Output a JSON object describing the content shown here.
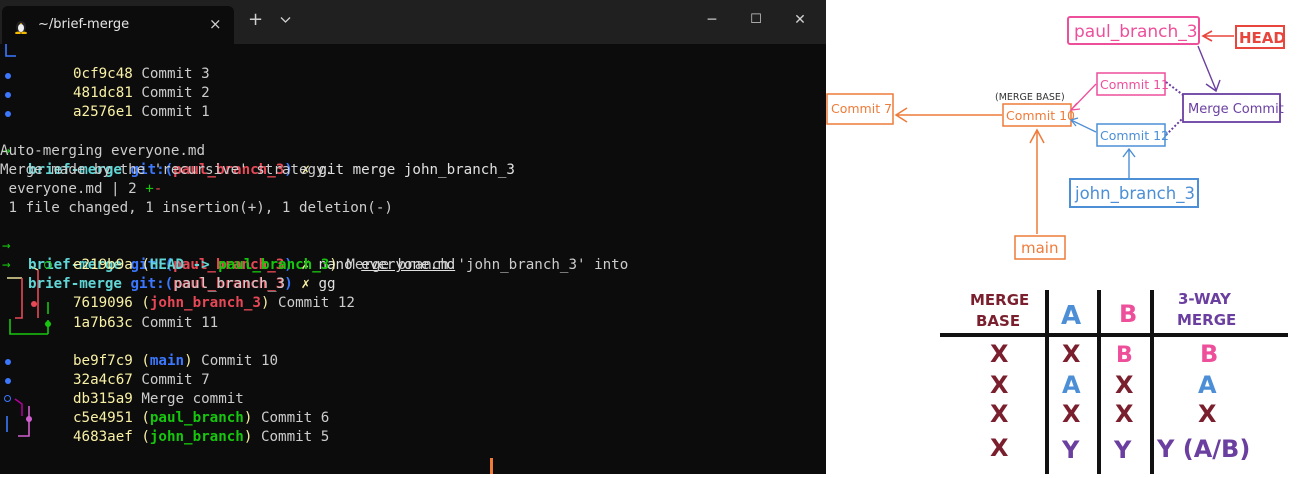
{
  "window": {
    "tab_title": "~/brief-merge",
    "new_tab": "+",
    "dropdown": "⌄",
    "close_tab": "×",
    "minimize": "─",
    "maximize": "☐",
    "close": "✕"
  },
  "terminal": {
    "l1": {
      "hash": "0cf9c48",
      "msg": " Commit 3"
    },
    "l2": {
      "hash": "481dc81",
      "msg": " Commit 2"
    },
    "l3": {
      "hash": "a2576e1",
      "msg": " Commit 1"
    },
    "p1": {
      "arrow": "→",
      "dir": "brief-merge",
      "git": "git:(",
      "branch": "paul_branch_3",
      "close": ")",
      "x": "✗",
      "cmd": "git merge john_branch_3"
    },
    "o1": "Auto-merging everyone.md",
    "o2": "Merge made by the 'recursive' strategy.",
    "o3": {
      "file": " everyone.md | 2 ",
      "plus": "+",
      "minus": "-"
    },
    "o4": " 1 file changed, 1 insertion(+), 1 deletion(-)",
    "p2": {
      "arrow": "→",
      "dir": "brief-merge",
      "git": "git:(",
      "branch": "paul_branch_3",
      "close": ")",
      "x": "✗",
      "cmd": "nano ",
      "file": "everyone.md"
    },
    "p3": {
      "arrow": "→",
      "dir": "brief-merge",
      "git": "git:(",
      "branch": "paul_branch_3",
      "close": ")",
      "x": "✗",
      "cmd": "gg"
    },
    "c1": {
      "hash": "e219b9a",
      "open": " (",
      "head": "HEAD -> ",
      "branch": "paul_branch_3",
      "close": ")",
      "msg": " Merge branch 'john_branch_3' into",
      "msg2": "paul_branch_3"
    },
    "c2": {
      "hash": "7619096",
      "open": " (",
      "branch": "john_branch_3",
      "close": ")",
      "msg": " Commit 12"
    },
    "c3": {
      "hash": "1a7b63c",
      "msg": " Commit 11"
    },
    "c4": {
      "hash": "be9f7c9",
      "open": " (",
      "branch": "main",
      "close": ")",
      "msg": " Commit 10"
    },
    "c5": {
      "hash": "32a4c67",
      "msg": " Commit 7"
    },
    "c6": {
      "hash": "db315a9",
      "msg": " Merge commit"
    },
    "c7": {
      "hash": "c5e4951",
      "open": " (",
      "branch": "paul_branch",
      "close": ")",
      "msg": " Commit 6"
    },
    "c8": {
      "hash": "4683aef",
      "open": " (",
      "branch": "john_branch",
      "close": ")",
      "msg": " Commit 5"
    }
  },
  "diagram": {
    "paul_branch": "paul_branch_3",
    "head": "HEAD",
    "commit11": "Commit 11",
    "merge_commit": "Merge Commit",
    "merge_base_label": "(MERGE BASE)",
    "commit10": "Commit 10",
    "commit7": "Commit 7",
    "commit12": "Commit 12",
    "john_branch": "john_branch_3",
    "main": "main",
    "colors": {
      "paul": "#ee4f9b",
      "head": "#e8453c",
      "john": "#4c8fd6",
      "merge": "#6a3fa0",
      "orange": "#ee7b3a"
    }
  },
  "table": {
    "headers": [
      "MERGE\nBASE",
      "A",
      "B",
      "3-WAY\nMERGE"
    ],
    "header_lines": {
      "h0a": "MERGE",
      "h0b": "BASE",
      "h1": "A",
      "h2": "B",
      "h3a": "3-WAY",
      "h3b": "MERGE"
    },
    "rows": [
      [
        "X",
        "X",
        "B",
        "B"
      ],
      [
        "X",
        "A",
        "X",
        "A"
      ],
      [
        "X",
        "X",
        "X",
        "X"
      ],
      [
        "X",
        "Y",
        "Y",
        "Y (A/B)"
      ]
    ],
    "colors": {
      "maroon": "#7a1f2e",
      "blue": "#4c8fd6",
      "pink": "#ee4f9b",
      "purple": "#6a3fa0"
    }
  }
}
